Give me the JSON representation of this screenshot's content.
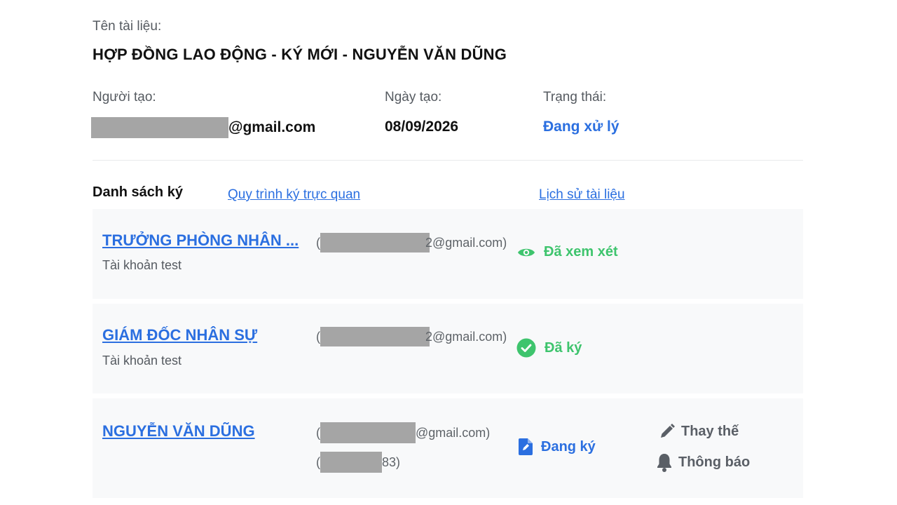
{
  "document": {
    "name_label": "Tên tài liệu:",
    "name": "HỢP ĐỒNG LAO ĐỘNG - KÝ MỚI - NGUYỄN VĂN DŨNG"
  },
  "meta": {
    "creator_label": "Người tạo:",
    "creator_email_suffix": "@gmail.com",
    "created_label": "Ngày tạo:",
    "created_date": "08/09/2026",
    "status_label": "Trạng thái:",
    "status_value": "Đang xử lý"
  },
  "signing": {
    "title": "Danh sách ký",
    "visual_flow_link": "Quy trình ký trực quan",
    "history_link": "Lịch sử tài liệu",
    "signers": [
      {
        "name": " TRƯỞNG PHÒNG NHÂN ...",
        "subtitle": "Tài khoản test",
        "email_open": "(",
        "email_tail": "2@gmail.com)",
        "status": "Đã xem xét",
        "status_icon": "eye-icon",
        "status_color": "#3ec46d"
      },
      {
        "name": " GIÁM ĐỐC NHÂN SỰ ",
        "subtitle": "Tài khoản test",
        "email_open": "(",
        "email_tail": "2@gmail.com)",
        "status": "Đã ký",
        "status_icon": "check-circle-icon",
        "status_color": "#3ec46d"
      },
      {
        "name": " NGUYỄN VĂN DŨNG ",
        "email_open": "(",
        "email_tail": "@gmail.com)",
        "phone_open": "(",
        "phone_tail": "83)",
        "status": "Đang ký",
        "status_icon": "file-edit-icon",
        "status_color": "#2b6fe0",
        "actions": [
          {
            "label": "Thay thế",
            "icon": "pencil-icon"
          },
          {
            "label": "Thông báo",
            "icon": "bell-icon"
          }
        ]
      }
    ]
  },
  "colors": {
    "accent": "#2b6fe0",
    "success": "#3ec46d",
    "row_bg": "#f8f9fa",
    "muted": "#555a60"
  }
}
